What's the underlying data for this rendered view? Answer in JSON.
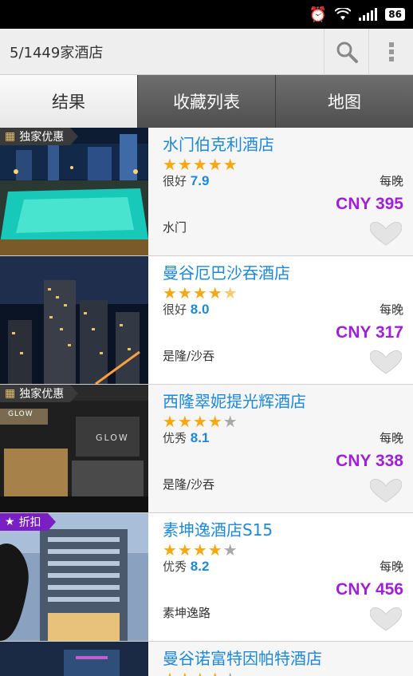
{
  "status": {
    "battery": "86"
  },
  "app_bar": {
    "title": "5/1449家酒店"
  },
  "tabs": [
    {
      "label": "结果"
    },
    {
      "label": "收藏列表"
    },
    {
      "label": "地图"
    }
  ],
  "hotels": [
    {
      "badge": "独家优惠",
      "name": "水门伯克利酒店",
      "stars": "5",
      "rating_text": "很好",
      "rating_score": "7.9",
      "per_night": "每晚",
      "price": "CNY 395",
      "area": "水门"
    },
    {
      "badge": "",
      "name": "曼谷厄巴沙吞酒店",
      "stars": "4.5",
      "rating_text": "很好",
      "rating_score": "8.0",
      "per_night": "每晚",
      "price": "CNY 317",
      "area": "是隆/沙吞"
    },
    {
      "badge": "独家优惠",
      "name": "西隆翠妮提光辉酒店",
      "stars": "4",
      "rating_text": "优秀",
      "rating_score": "8.1",
      "per_night": "每晚",
      "price": "CNY 338",
      "area": "是隆/沙吞"
    },
    {
      "badge": "折扣",
      "name": "素坤逸酒店S15",
      "stars": "4",
      "rating_text": "优秀",
      "rating_score": "8.2",
      "per_night": "每晚",
      "price": "CNY 456",
      "area": "素坤逸路"
    },
    {
      "badge": "",
      "name": "曼谷诺富特因帕特酒店",
      "stars": "4"
    }
  ],
  "photo_signs": {
    "glow": "GLOW"
  },
  "colors": {
    "accent_blue": "#1e88d8",
    "price_purple": "#a020d8",
    "star_gold": "#f5a812",
    "badge_purple": "#7a1fc4"
  }
}
